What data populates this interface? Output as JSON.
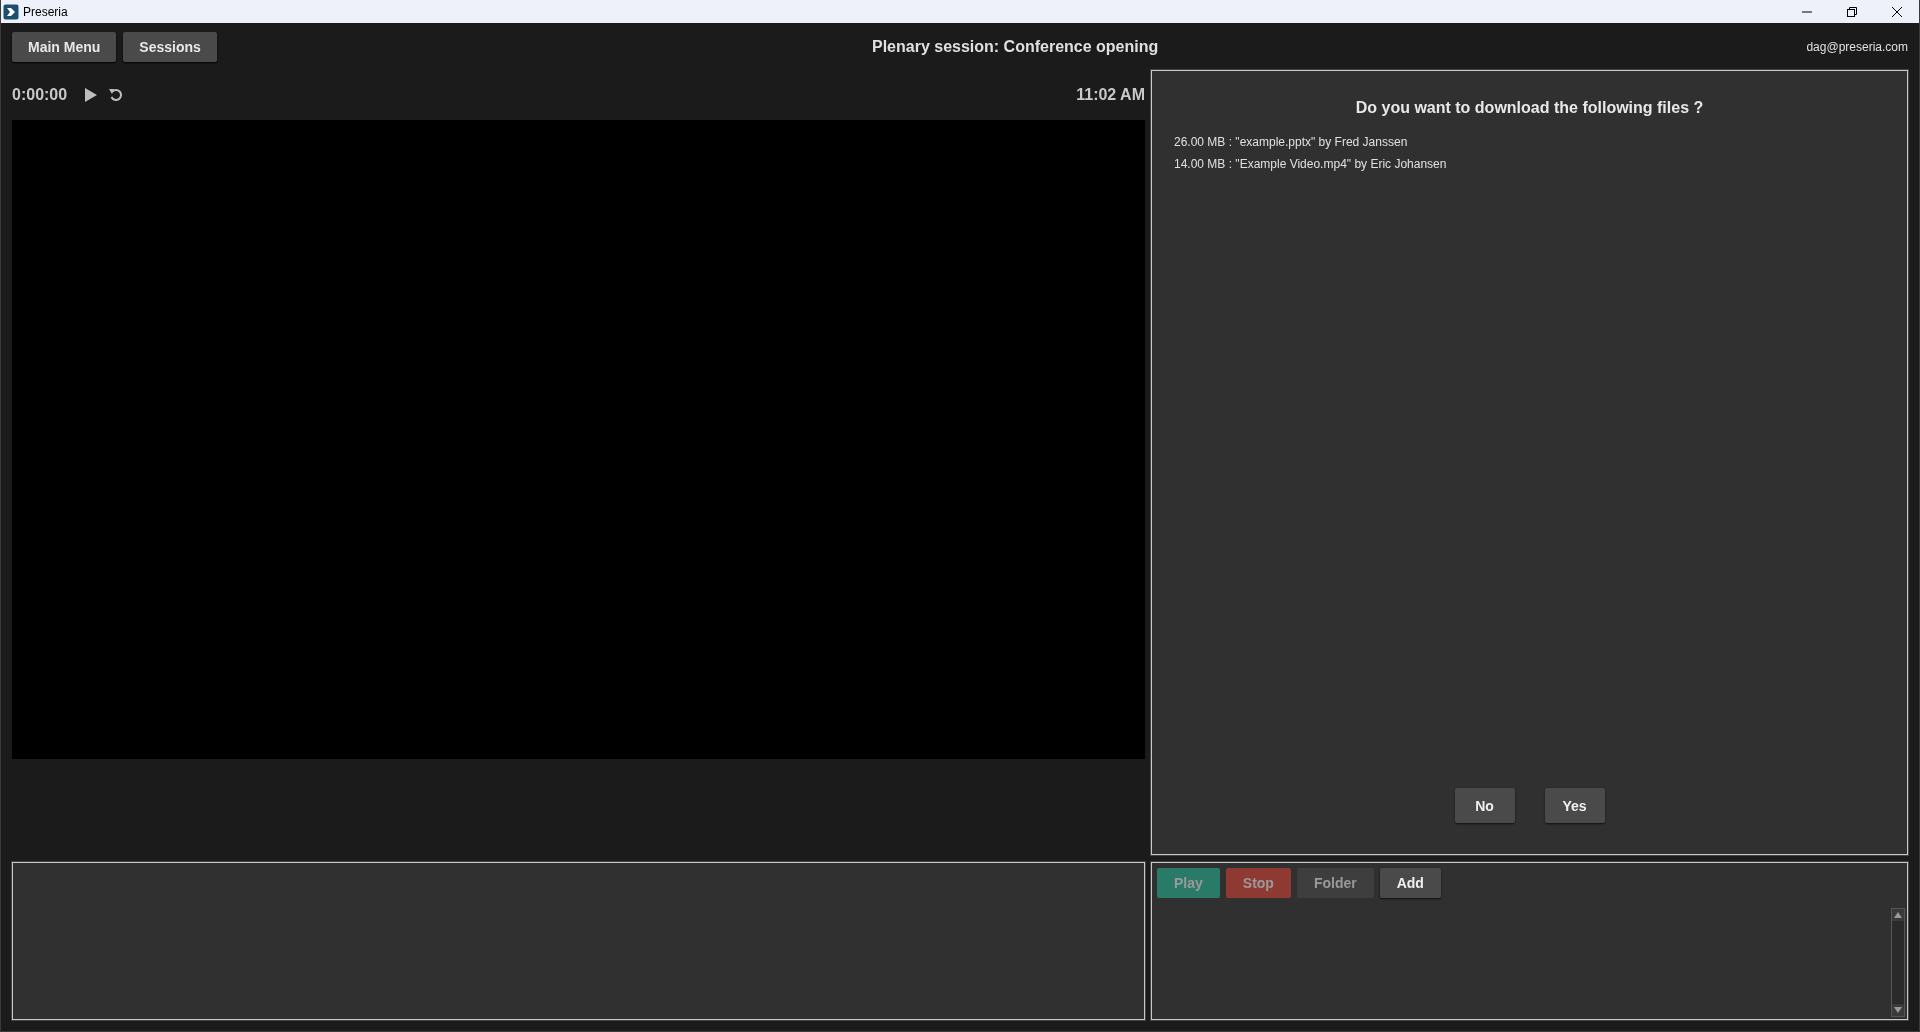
{
  "window": {
    "title": "Preseria"
  },
  "header": {
    "buttons": [
      "Main Menu",
      "Sessions"
    ],
    "title": "Plenary session: Conference opening",
    "user": "dag@preseria.com"
  },
  "player": {
    "time": "0:00:00",
    "clock": "11:02 AM"
  },
  "dialog": {
    "question": "Do you want to download the following files ?",
    "files": [
      "26.00 MB : \"example.pptx\" by Fred Janssen",
      "14.00 MB : \"Example Video.mp4\" by Eric Johansen"
    ],
    "buttons": [
      "No",
      "Yes"
    ]
  },
  "toolbar": [
    {
      "label": "Play",
      "kind": "play",
      "disabled": true
    },
    {
      "label": "Stop",
      "kind": "stop",
      "disabled": true
    },
    {
      "label": "Folder",
      "kind": "plain",
      "disabled": true
    },
    {
      "label": "Add",
      "kind": "plain",
      "disabled": false
    }
  ]
}
